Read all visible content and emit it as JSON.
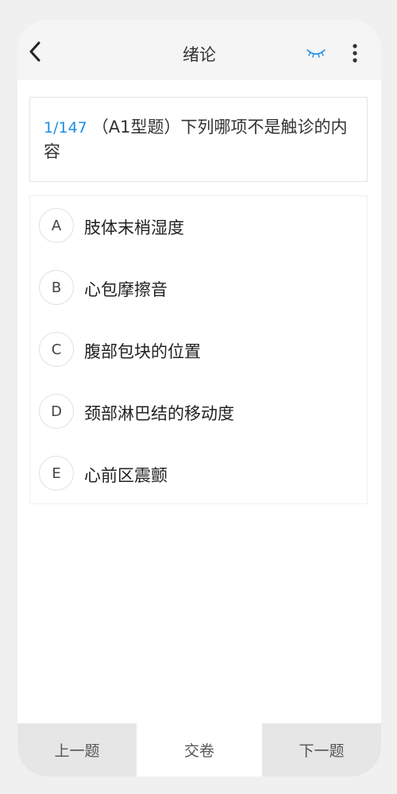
{
  "header": {
    "title": "绪论",
    "back_icon": "chevron-left-icon",
    "eye_icon": "eye-closed-icon",
    "more_icon": "more-vertical-icon",
    "accent_color": "#1e8fe6"
  },
  "question": {
    "index": "1/147",
    "text": "（A1型题）下列哪项不是触诊的内容"
  },
  "options": [
    {
      "letter": "A",
      "text": "肢体末梢湿度"
    },
    {
      "letter": "B",
      "text": "心包摩擦音"
    },
    {
      "letter": "C",
      "text": "腹部包块的位置"
    },
    {
      "letter": "D",
      "text": "颈部淋巴结的移动度"
    },
    {
      "letter": "E",
      "text": "心前区震颤"
    }
  ],
  "footer": {
    "prev_label": "上一题",
    "submit_label": "交卷",
    "next_label": "下一题"
  }
}
